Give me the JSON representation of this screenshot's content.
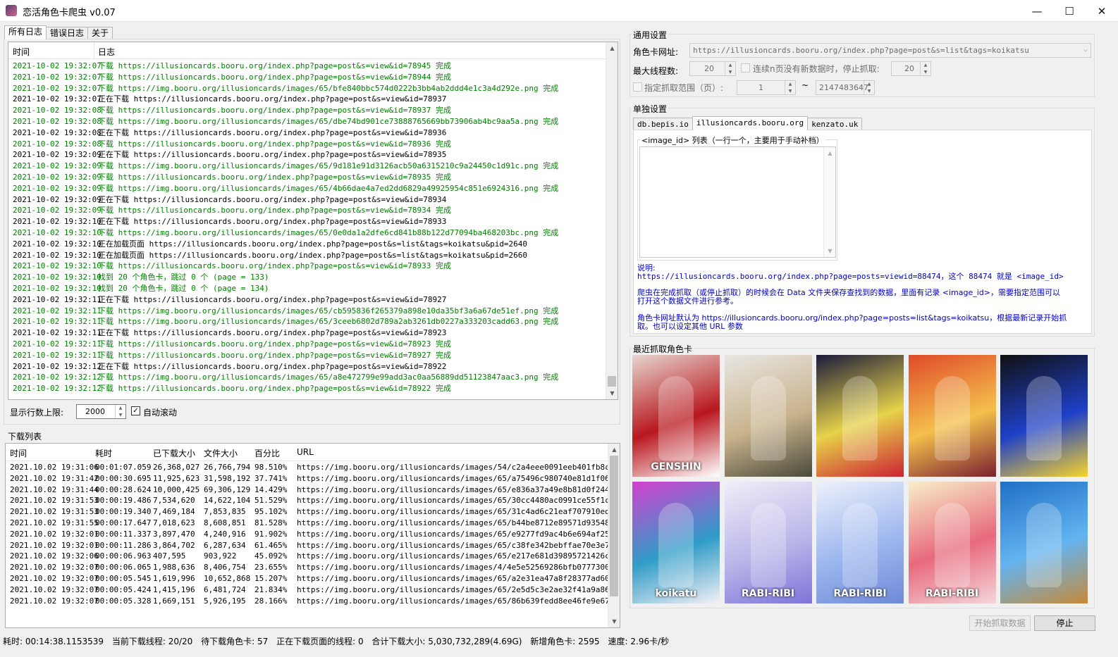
{
  "window": {
    "title": "恋活角色卡爬虫 v0.07",
    "minimize": "—",
    "maximize": "☐",
    "close": "✕"
  },
  "log_tabs": [
    "所有日志",
    "错误日志",
    "关于"
  ],
  "log": {
    "col_time": "时间",
    "col_log": "日志",
    "rows": [
      {
        "time": "2021-10-02 19:32:07",
        "text": "下载 https://illusioncards.booru.org/index.php?page=post&s=view&id=78945 完成",
        "color": "green"
      },
      {
        "time": "2021-10-02 19:32:07",
        "text": "下载 https://illusioncards.booru.org/index.php?page=post&s=view&id=78944 完成",
        "color": "green"
      },
      {
        "time": "2021-10-02 19:32:07",
        "text": "下载 https://img.booru.org/illusioncards/images/65/bfe840bbc574d0222b3bb4ab2ddd4e1c3a4d292e.png 完成",
        "color": "green"
      },
      {
        "time": "2021-10-02 19:32:07",
        "text": "正在下载 https://illusioncards.booru.org/index.php?page=post&s=view&id=78937",
        "color": "black"
      },
      {
        "time": "2021-10-02 19:32:08",
        "text": "下载 https://illusioncards.booru.org/index.php?page=post&s=view&id=78937 完成",
        "color": "green"
      },
      {
        "time": "2021-10-02 19:32:08",
        "text": "下载 https://img.booru.org/illusioncards/images/65/dbe74bd901ce73888765669bb73906ab4bc9aa5a.png 完成",
        "color": "green"
      },
      {
        "time": "2021-10-02 19:32:08",
        "text": "正在下载 https://illusioncards.booru.org/index.php?page=post&s=view&id=78936",
        "color": "black"
      },
      {
        "time": "2021-10-02 19:32:08",
        "text": "下载 https://illusioncards.booru.org/index.php?page=post&s=view&id=78936 完成",
        "color": "green"
      },
      {
        "time": "2021-10-02 19:32:09",
        "text": "正在下载 https://illusioncards.booru.org/index.php?page=post&s=view&id=78935",
        "color": "black"
      },
      {
        "time": "2021-10-02 19:32:09",
        "text": "下载 https://img.booru.org/illusioncards/images/65/9d181e91d3126acb50a6315210c9a24450c1d91c.png 完成",
        "color": "green"
      },
      {
        "time": "2021-10-02 19:32:09",
        "text": "下载 https://illusioncards.booru.org/index.php?page=post&s=view&id=78935 完成",
        "color": "green"
      },
      {
        "time": "2021-10-02 19:32:09",
        "text": "下载 https://img.booru.org/illusioncards/images/65/4b66dae4a7ed2dd6829a49925954c851e6924316.png 完成",
        "color": "green"
      },
      {
        "time": "2021-10-02 19:32:09",
        "text": "正在下载 https://illusioncards.booru.org/index.php?page=post&s=view&id=78934",
        "color": "black"
      },
      {
        "time": "2021-10-02 19:32:09",
        "text": "下载 https://illusioncards.booru.org/index.php?page=post&s=view&id=78934 完成",
        "color": "green"
      },
      {
        "time": "2021-10-02 19:32:10",
        "text": "正在下载 https://illusioncards.booru.org/index.php?page=post&s=view&id=78933",
        "color": "black"
      },
      {
        "time": "2021-10-02 19:32:10",
        "text": "下载 https://img.booru.org/illusioncards/images/65/0e0da1a2dfe6cd841b88b122d77094ba468203bc.png 完成",
        "color": "green"
      },
      {
        "time": "2021-10-02 19:32:10",
        "text": "正在加载页面 https://illusioncards.booru.org/index.php?page=post&s=list&tags=koikatsu&pid=2640",
        "color": "black"
      },
      {
        "time": "2021-10-02 19:32:10",
        "text": "正在加载页面 https://illusioncards.booru.org/index.php?page=post&s=list&tags=koikatsu&pid=2660",
        "color": "black"
      },
      {
        "time": "2021-10-02 19:32:10",
        "text": "下载 https://illusioncards.booru.org/index.php?page=post&s=view&id=78933 完成",
        "color": "green"
      },
      {
        "time": "2021-10-02 19:32:10",
        "text": "找到 20 个角色卡，跳过 0 个 (page = 133)",
        "color": "green"
      },
      {
        "time": "2021-10-02 19:32:10",
        "text": "找到 20 个角色卡，跳过 0 个 (page = 134)",
        "color": "green"
      },
      {
        "time": "2021-10-02 19:32:11",
        "text": "正在下载 https://illusioncards.booru.org/index.php?page=post&s=view&id=78927",
        "color": "black"
      },
      {
        "time": "2021-10-02 19:32:11",
        "text": "下载 https://img.booru.org/illusioncards/images/65/cb595836f265379a898e10da35bf3a6a67de51ef.png 完成",
        "color": "green"
      },
      {
        "time": "2021-10-02 19:32:11",
        "text": "下载 https://img.booru.org/illusioncards/images/65/3ceeb6802d789a2ab3261db0227a333203cadd63.png 完成",
        "color": "green"
      },
      {
        "time": "2021-10-02 19:32:11",
        "text": "正在下载 https://illusioncards.booru.org/index.php?page=post&s=view&id=78923",
        "color": "black"
      },
      {
        "time": "2021-10-02 19:32:11",
        "text": "下载 https://illusioncards.booru.org/index.php?page=post&s=view&id=78923 完成",
        "color": "green"
      },
      {
        "time": "2021-10-02 19:32:11",
        "text": "下载 https://illusioncards.booru.org/index.php?page=post&s=view&id=78927 完成",
        "color": "green"
      },
      {
        "time": "2021-10-02 19:32:12",
        "text": "正在下载 https://illusioncards.booru.org/index.php?page=post&s=view&id=78922",
        "color": "black"
      },
      {
        "time": "2021-10-02 19:32:12",
        "text": "下载 https://img.booru.org/illusioncards/images/65/a8e472799e99add3ac0aa56889dd51123847aac3.png 完成",
        "color": "green"
      },
      {
        "time": "2021-10-02 19:32:12",
        "text": "下载 https://illusioncards.booru.org/index.php?page=post&s=view&id=78922 完成",
        "color": "green"
      }
    ]
  },
  "log_options": {
    "max_rows_label": "显示行数上限:",
    "max_rows_value": "2000",
    "auto_scroll_label": "自动滚动",
    "auto_scroll_checked": "✓"
  },
  "download_list": {
    "title": "下载列表",
    "columns": [
      "时间",
      "耗时",
      "已下载大小",
      "文件大小",
      "百分比",
      "URL"
    ],
    "rows": [
      [
        "2021.10.02 19:31:06",
        "00:01:07.059",
        "26,368,027",
        "26,766,794",
        "98.510%",
        "https://img.booru.org/illusioncards/images/54/c2a4eee0091eeb401fb8ce6f..."
      ],
      [
        "2021.10.02 19:31:42",
        "00:00:30.695",
        "11,925,623",
        "31,598,192",
        "37.741%",
        "https://img.booru.org/illusioncards/images/65/a75496c980740e81d1f065cd..."
      ],
      [
        "2021.10.02 19:31:44",
        "00:00:28.624",
        "10,000,425",
        "69,306,129",
        "14.429%",
        "https://img.booru.org/illusioncards/images/65/e836a37a49e8b81d0f244ae0..."
      ],
      [
        "2021.10.02 19:31:53",
        "00:00:19.486",
        "7,534,620",
        "14,622,104",
        "51.529%",
        "https://img.booru.org/illusioncards/images/65/30cc4480ac0991ce55f1c033..."
      ],
      [
        "2021.10.02 19:31:53",
        "00:00:19.340",
        "7,469,184",
        "7,853,835",
        "95.102%",
        "https://img.booru.org/illusioncards/images/65/31c4ad6c21eaf707910edf49..."
      ],
      [
        "2021.10.02 19:31:55",
        "00:00:17.647",
        "7,018,623",
        "8,608,851",
        "81.528%",
        "https://img.booru.org/illusioncards/images/65/b44be8712e89571d93548f0c..."
      ],
      [
        "2021.10.02 19:32:01",
        "00:00:11.337",
        "3,897,470",
        "4,240,916",
        "91.902%",
        "https://img.booru.org/illusioncards/images/65/e9277fd9ac4b6e694af25882..."
      ],
      [
        "2021.10.02 19:32:01",
        "00:00:11.286",
        "3,864,702",
        "6,287,634",
        "61.465%",
        "https://img.booru.org/illusioncards/images/65/c38fe342bebffae70e3e7d49..."
      ],
      [
        "2021.10.02 19:32:06",
        "00:00:06.963",
        "407,595",
        "903,922",
        "45.092%",
        "https://img.booru.org/illusioncards/images/65/e217e681d39895721426ca8..."
      ],
      [
        "2021.10.02 19:32:07",
        "00:00:06.065",
        "1,988,636",
        "8,406,754",
        "23.655%",
        "https://img.booru.org/illusioncards/images/4/4e5e52569286bfb0777300512..."
      ],
      [
        "2021.10.02 19:32:07",
        "00:00:05.545",
        "1,619,996",
        "10,652,868",
        "15.207%",
        "https://img.booru.org/illusioncards/images/65/a2e31ea47a8f28377ad60940..."
      ],
      [
        "2021.10.02 19:32:07",
        "00:00:05.424",
        "1,415,196",
        "6,481,724",
        "21.834%",
        "https://img.booru.org/illusioncards/images/65/2e5d5c3e2ae32f41a9a86a5a..."
      ],
      [
        "2021.10.02 19:32:07",
        "00:00:05.328",
        "1,669,151",
        "5,926,195",
        "28.166%",
        "https://img.booru.org/illusioncards/images/65/86b639fedd8ee46fe9e678e6..."
      ]
    ]
  },
  "general_settings": {
    "title": "通用设置",
    "url_label": "角色卡网址:",
    "url_value": "https://illusioncards.booru.org/index.php?page=post&s=list&tags=koikatsu",
    "threads_label": "最大线程数:",
    "threads_value": "20",
    "stop_label": "连续n页没有新数据时，停止抓取:",
    "stop_value": "20",
    "range_label": "指定抓取范围（页）:",
    "range_from": "1",
    "range_sep": "~",
    "range_to": "2147483647"
  },
  "site_settings": {
    "title": "单独设置",
    "tabs": [
      "db.bepis.io",
      "illusioncards.booru.org",
      "kenzato.uk"
    ],
    "list_group_title": "<image_id> 列表（一行一个，主要用于手动补档）",
    "notes": [
      "说明:",
      "https://illusioncards.booru.org/index.php?page=posts=viewid=88474，这个 88474 就是 <image_id>",
      "爬虫在完成抓取（或停止抓取）的时候会在 Data 文件夹保存查找到的数据，里面有记录 <image_id>，需要指定范围可以",
      "打开这个数据文件进行参考。",
      "角色卡网址默认为 https://illusioncards.booru.org/index.php?page=posts=list&tags=koikatsu，根据最新记录开始抓",
      "取。也可以设定其他 URL 参数"
    ]
  },
  "recent_cards": {
    "title": "最近抓取角色卡",
    "cards": [
      {
        "caption": "GENSHIN",
        "colors": [
          "#e7d6cf",
          "#b8171e",
          "#ffffff"
        ]
      },
      {
        "caption": "",
        "colors": [
          "#e8e6e2",
          "#c9b38d",
          "#4a4a3a"
        ]
      },
      {
        "caption": "",
        "colors": [
          "#1b1b3a",
          "#e7d24a",
          "#cc2233"
        ]
      },
      {
        "caption": "",
        "colors": [
          "#e04a2a",
          "#f4c04c",
          "#7a2030"
        ]
      },
      {
        "caption": "",
        "colors": [
          "#101010",
          "#1e40c8",
          "#f7d42b"
        ]
      },
      {
        "caption": "koikatu",
        "colors": [
          "#d43fd0",
          "#2f9cc7",
          "#f5f0f5"
        ]
      },
      {
        "caption": "RABI-RIBI",
        "colors": [
          "#f1edf8",
          "#b9b7e9",
          "#7e74d9"
        ]
      },
      {
        "caption": "RABI-RIBI",
        "colors": [
          "#eef1fb",
          "#9db7ef",
          "#6f8ad8"
        ]
      },
      {
        "caption": "RABI-RIBI",
        "colors": [
          "#f7efc8",
          "#e8697d",
          "#f3d6da"
        ]
      },
      {
        "caption": "",
        "colors": [
          "#1f6fc7",
          "#63b4f0",
          "#c68a3a"
        ]
      }
    ]
  },
  "buttons": {
    "start": "开始抓取数据",
    "stop": "停止"
  },
  "status": [
    "耗时: 00:14:38.1153539",
    "当前下载线程: 20/20",
    "待下载角色卡: 57",
    "正在下载页面的线程: 0",
    "合计下载大小: 5,030,732,289(4.69G)",
    "新增角色卡: 2595",
    "速度: 2.96卡/秒"
  ]
}
